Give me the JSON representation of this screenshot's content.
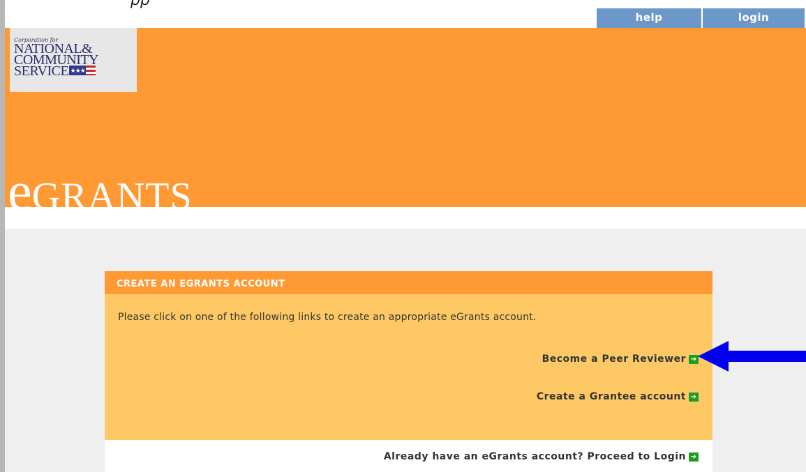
{
  "top_strip": {
    "clipped_text": "pp"
  },
  "topnav": {
    "help": "help",
    "login": "login"
  },
  "logo": {
    "line1": "Corporation for",
    "line2": "NATIONAL&",
    "line3": "COMMUNITY",
    "line4": "SERVICE",
    "stars": "★★★"
  },
  "wordmark": {
    "e": "e",
    "rest": "GRANTS"
  },
  "panel": {
    "title": "CREATE AN EGRANTS ACCOUNT",
    "intro": "Please click on one of the following links to create an appropriate eGrants account.",
    "links": {
      "peer": "Become a Peer Reviewer",
      "grantee": "Create a Grantee account",
      "login": "Already have an eGrants account? Proceed to Login"
    }
  },
  "colors": {
    "orange": "#fe9933",
    "panel_body": "#fec964",
    "nav_blue": "#6b98c8",
    "arrow_blue": "#0000ee",
    "go_green": "#1e9d1e"
  }
}
